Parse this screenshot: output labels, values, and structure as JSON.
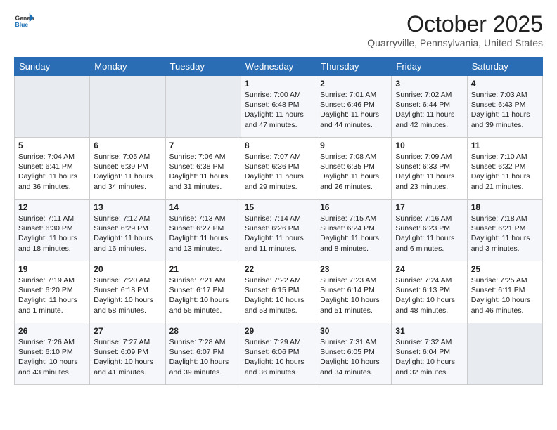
{
  "header": {
    "logo_line1": "General",
    "logo_line2": "Blue",
    "title": "October 2025",
    "subtitle": "Quarryville, Pennsylvania, United States"
  },
  "days_of_week": [
    "Sunday",
    "Monday",
    "Tuesday",
    "Wednesday",
    "Thursday",
    "Friday",
    "Saturday"
  ],
  "weeks": [
    [
      {
        "day": "",
        "empty": true
      },
      {
        "day": "",
        "empty": true
      },
      {
        "day": "",
        "empty": true
      },
      {
        "day": "1",
        "sunrise": "7:00 AM",
        "sunset": "6:48 PM",
        "daylight": "11 hours and 47 minutes."
      },
      {
        "day": "2",
        "sunrise": "7:01 AM",
        "sunset": "6:46 PM",
        "daylight": "11 hours and 44 minutes."
      },
      {
        "day": "3",
        "sunrise": "7:02 AM",
        "sunset": "6:44 PM",
        "daylight": "11 hours and 42 minutes."
      },
      {
        "day": "4",
        "sunrise": "7:03 AM",
        "sunset": "6:43 PM",
        "daylight": "11 hours and 39 minutes."
      }
    ],
    [
      {
        "day": "5",
        "sunrise": "7:04 AM",
        "sunset": "6:41 PM",
        "daylight": "11 hours and 36 minutes."
      },
      {
        "day": "6",
        "sunrise": "7:05 AM",
        "sunset": "6:39 PM",
        "daylight": "11 hours and 34 minutes."
      },
      {
        "day": "7",
        "sunrise": "7:06 AM",
        "sunset": "6:38 PM",
        "daylight": "11 hours and 31 minutes."
      },
      {
        "day": "8",
        "sunrise": "7:07 AM",
        "sunset": "6:36 PM",
        "daylight": "11 hours and 29 minutes."
      },
      {
        "day": "9",
        "sunrise": "7:08 AM",
        "sunset": "6:35 PM",
        "daylight": "11 hours and 26 minutes."
      },
      {
        "day": "10",
        "sunrise": "7:09 AM",
        "sunset": "6:33 PM",
        "daylight": "11 hours and 23 minutes."
      },
      {
        "day": "11",
        "sunrise": "7:10 AM",
        "sunset": "6:32 PM",
        "daylight": "11 hours and 21 minutes."
      }
    ],
    [
      {
        "day": "12",
        "sunrise": "7:11 AM",
        "sunset": "6:30 PM",
        "daylight": "11 hours and 18 minutes."
      },
      {
        "day": "13",
        "sunrise": "7:12 AM",
        "sunset": "6:29 PM",
        "daylight": "11 hours and 16 minutes."
      },
      {
        "day": "14",
        "sunrise": "7:13 AM",
        "sunset": "6:27 PM",
        "daylight": "11 hours and 13 minutes."
      },
      {
        "day": "15",
        "sunrise": "7:14 AM",
        "sunset": "6:26 PM",
        "daylight": "11 hours and 11 minutes."
      },
      {
        "day": "16",
        "sunrise": "7:15 AM",
        "sunset": "6:24 PM",
        "daylight": "11 hours and 8 minutes."
      },
      {
        "day": "17",
        "sunrise": "7:16 AM",
        "sunset": "6:23 PM",
        "daylight": "11 hours and 6 minutes."
      },
      {
        "day": "18",
        "sunrise": "7:18 AM",
        "sunset": "6:21 PM",
        "daylight": "11 hours and 3 minutes."
      }
    ],
    [
      {
        "day": "19",
        "sunrise": "7:19 AM",
        "sunset": "6:20 PM",
        "daylight": "11 hours and 1 minute."
      },
      {
        "day": "20",
        "sunrise": "7:20 AM",
        "sunset": "6:18 PM",
        "daylight": "10 hours and 58 minutes."
      },
      {
        "day": "21",
        "sunrise": "7:21 AM",
        "sunset": "6:17 PM",
        "daylight": "10 hours and 56 minutes."
      },
      {
        "day": "22",
        "sunrise": "7:22 AM",
        "sunset": "6:15 PM",
        "daylight": "10 hours and 53 minutes."
      },
      {
        "day": "23",
        "sunrise": "7:23 AM",
        "sunset": "6:14 PM",
        "daylight": "10 hours and 51 minutes."
      },
      {
        "day": "24",
        "sunrise": "7:24 AM",
        "sunset": "6:13 PM",
        "daylight": "10 hours and 48 minutes."
      },
      {
        "day": "25",
        "sunrise": "7:25 AM",
        "sunset": "6:11 PM",
        "daylight": "10 hours and 46 minutes."
      }
    ],
    [
      {
        "day": "26",
        "sunrise": "7:26 AM",
        "sunset": "6:10 PM",
        "daylight": "10 hours and 43 minutes."
      },
      {
        "day": "27",
        "sunrise": "7:27 AM",
        "sunset": "6:09 PM",
        "daylight": "10 hours and 41 minutes."
      },
      {
        "day": "28",
        "sunrise": "7:28 AM",
        "sunset": "6:07 PM",
        "daylight": "10 hours and 39 minutes."
      },
      {
        "day": "29",
        "sunrise": "7:29 AM",
        "sunset": "6:06 PM",
        "daylight": "10 hours and 36 minutes."
      },
      {
        "day": "30",
        "sunrise": "7:31 AM",
        "sunset": "6:05 PM",
        "daylight": "10 hours and 34 minutes."
      },
      {
        "day": "31",
        "sunrise": "7:32 AM",
        "sunset": "6:04 PM",
        "daylight": "10 hours and 32 minutes."
      },
      {
        "day": "",
        "empty": true
      }
    ]
  ],
  "labels": {
    "sunrise": "Sunrise:",
    "sunset": "Sunset:",
    "daylight": "Daylight:"
  }
}
